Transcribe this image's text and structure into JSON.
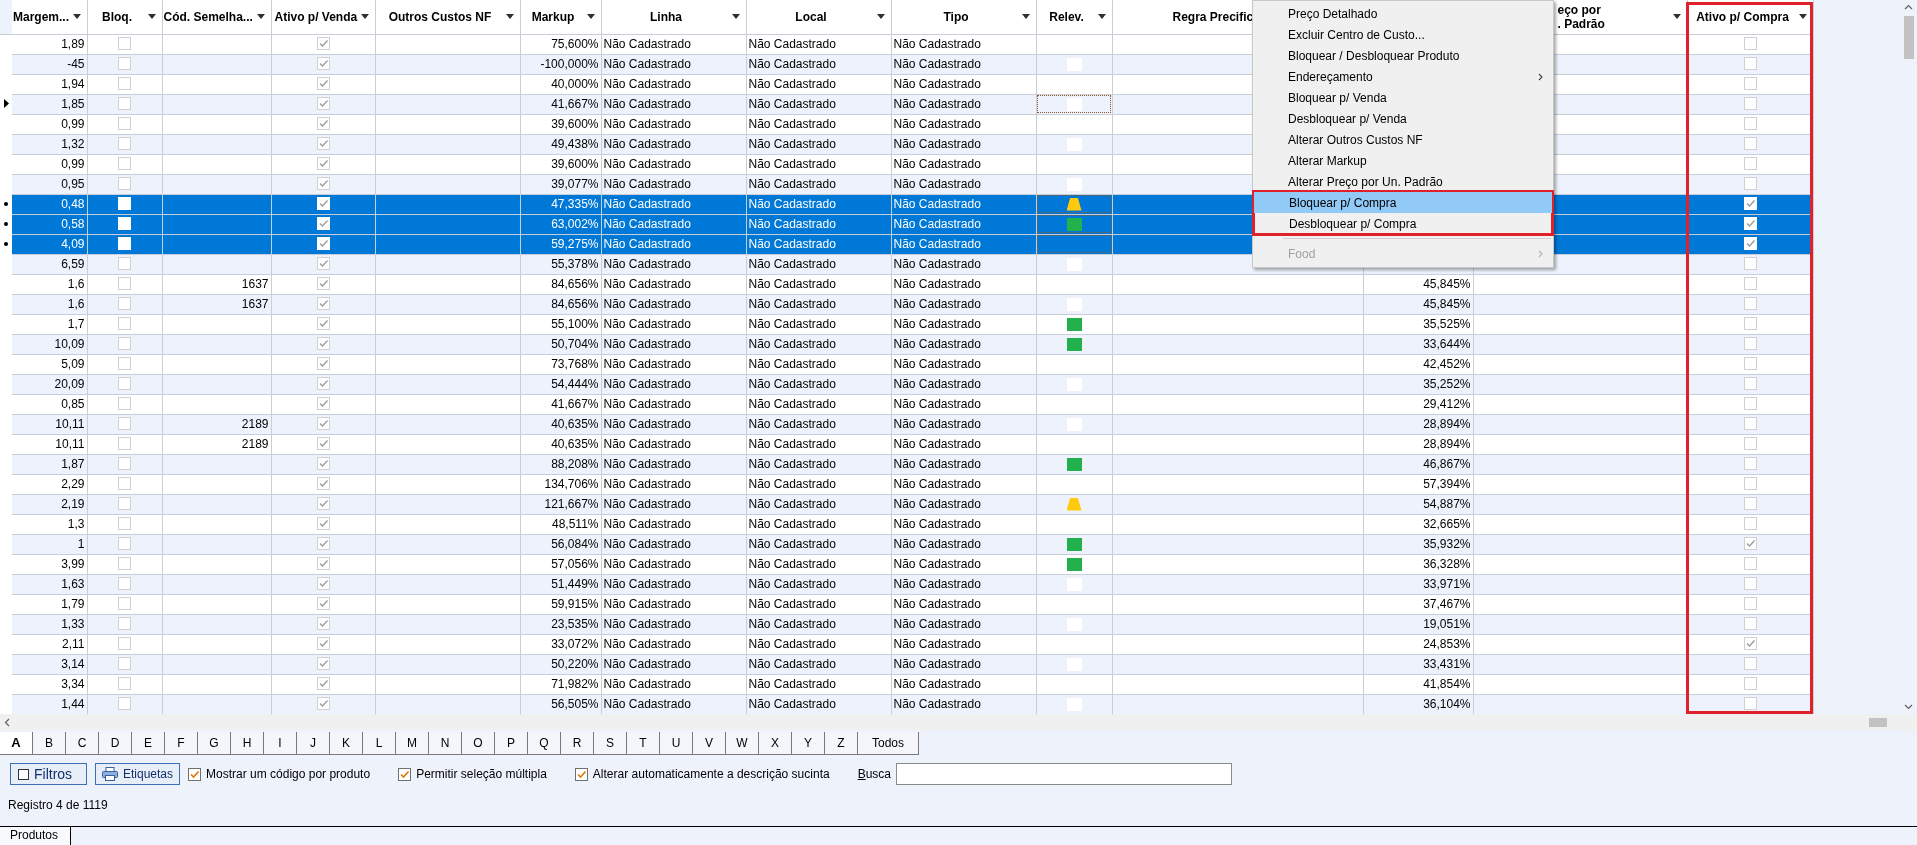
{
  "grid": {
    "columns": [
      {
        "label": "Margem...",
        "kind": "number",
        "dropdown": true
      },
      {
        "label": "Bloq.",
        "kind": "check",
        "dropdown": true
      },
      {
        "label": "Cód. Semelha...",
        "kind": "number",
        "dropdown": true
      },
      {
        "label": "Ativo p/ Venda",
        "kind": "check",
        "dropdown": true
      },
      {
        "label": "Outros Custos NF",
        "kind": "number",
        "dropdown": true
      },
      {
        "label": "Markup",
        "kind": "number",
        "dropdown": true
      },
      {
        "label": "Linha",
        "kind": "text",
        "dropdown": true
      },
      {
        "label": "Local",
        "kind": "text",
        "dropdown": true
      },
      {
        "label": "Tipo",
        "kind": "text",
        "dropdown": true
      },
      {
        "label": "Relev.",
        "kind": "marker",
        "dropdown": true
      },
      {
        "label": "Regra Precific",
        "kind": "text"
      },
      {
        "kind": "number"
      },
      {
        "lines": [
          "eço por",
          ". Padrão"
        ],
        "kind": "number",
        "dropdown": true
      },
      {
        "label": "Ativo p/ Compra",
        "kind": "check",
        "dropdown": true,
        "boxed": true
      }
    ],
    "rows": [
      {
        "selected": false,
        "current": false,
        "cells": [
          "1,89",
          {
            "checked": false
          },
          null,
          {
            "checked": true
          },
          null,
          "75,600%",
          "Não Cadastrado",
          "Não Cadastrado",
          "Não Cadastrado",
          null,
          null,
          null,
          null,
          {
            "checked": false
          }
        ]
      },
      {
        "selected": false,
        "current": false,
        "cells": [
          "-45",
          {
            "checked": false
          },
          null,
          {
            "checked": true
          },
          null,
          "-100,000%",
          "Não Cadastrado",
          "Não Cadastrado",
          "Não Cadastrado",
          {
            "kind": "square",
            "color": "#ffffff"
          },
          null,
          null,
          null,
          {
            "checked": false
          }
        ]
      },
      {
        "selected": false,
        "current": false,
        "cells": [
          "1,94",
          {
            "checked": false
          },
          null,
          {
            "checked": true
          },
          null,
          "40,000%",
          "Não Cadastrado",
          "Não Cadastrado",
          "Não Cadastrado",
          null,
          null,
          null,
          null,
          {
            "checked": false
          }
        ]
      },
      {
        "selected": false,
        "current": true,
        "cells": [
          "1,85",
          {
            "checked": false
          },
          null,
          {
            "checked": true
          },
          null,
          "41,667%",
          "Não Cadastrado",
          "Não Cadastrado",
          "Não Cadastrado",
          {
            "kind": "square",
            "color": "#ffffff"
          },
          null,
          null,
          null,
          {
            "checked": false
          }
        ]
      },
      {
        "selected": false,
        "current": false,
        "cells": [
          "0,99",
          {
            "checked": false
          },
          null,
          {
            "checked": true
          },
          null,
          "39,600%",
          "Não Cadastrado",
          "Não Cadastrado",
          "Não Cadastrado",
          null,
          null,
          null,
          null,
          {
            "checked": false
          }
        ]
      },
      {
        "selected": false,
        "current": false,
        "cells": [
          "1,32",
          {
            "checked": false
          },
          null,
          {
            "checked": true
          },
          null,
          "49,438%",
          "Não Cadastrado",
          "Não Cadastrado",
          "Não Cadastrado",
          {
            "kind": "square",
            "color": "#ffffff"
          },
          null,
          null,
          null,
          {
            "checked": false
          }
        ]
      },
      {
        "selected": false,
        "current": false,
        "cells": [
          "0,99",
          {
            "checked": false
          },
          null,
          {
            "checked": true
          },
          null,
          "39,600%",
          "Não Cadastrado",
          "Não Cadastrado",
          "Não Cadastrado",
          null,
          null,
          null,
          null,
          {
            "checked": false
          }
        ]
      },
      {
        "selected": false,
        "current": false,
        "cells": [
          "0,95",
          {
            "checked": false
          },
          null,
          {
            "checked": true
          },
          null,
          "39,077%",
          "Não Cadastrado",
          "Não Cadastrado",
          "Não Cadastrado",
          {
            "kind": "square",
            "color": "#ffffff"
          },
          null,
          null,
          null,
          {
            "checked": false
          }
        ]
      },
      {
        "selected": true,
        "current": false,
        "cells": [
          "0,48",
          {
            "checked": false
          },
          null,
          {
            "checked": true
          },
          null,
          "47,335%",
          "Não Cadastrado",
          "Não Cadastrado",
          "Não Cadastrado",
          {
            "kind": "trapezoid",
            "color": "#ffc90e"
          },
          null,
          null,
          null,
          {
            "checked": true
          }
        ]
      },
      {
        "selected": true,
        "current": false,
        "cells": [
          "0,58",
          {
            "checked": false
          },
          null,
          {
            "checked": true
          },
          null,
          "63,002%",
          "Não Cadastrado",
          "Não Cadastrado",
          "Não Cadastrado",
          {
            "kind": "square",
            "color": "#22b14c"
          },
          null,
          null,
          null,
          {
            "checked": true
          }
        ]
      },
      {
        "selected": true,
        "current": false,
        "cells": [
          "4,09",
          {
            "checked": false
          },
          null,
          {
            "checked": true
          },
          null,
          "59,275%",
          "Não Cadastrado",
          "Não Cadastrado",
          "Não Cadastrado",
          null,
          null,
          null,
          null,
          {
            "checked": true
          }
        ]
      },
      {
        "selected": false,
        "current": false,
        "cells": [
          "6,59",
          {
            "checked": false
          },
          null,
          {
            "checked": true
          },
          null,
          "55,378%",
          "Não Cadastrado",
          "Não Cadastrado",
          "Não Cadastrado",
          {
            "kind": "square",
            "color": "#ffffff"
          },
          null,
          null,
          null,
          {
            "checked": false
          }
        ]
      },
      {
        "selected": false,
        "current": false,
        "cells": [
          "1,6",
          {
            "checked": false
          },
          "1637",
          {
            "checked": true
          },
          null,
          "84,656%",
          "Não Cadastrado",
          "Não Cadastrado",
          "Não Cadastrado",
          null,
          null,
          "45,845%",
          null,
          {
            "checked": false
          }
        ]
      },
      {
        "selected": false,
        "current": false,
        "cells": [
          "1,6",
          {
            "checked": false
          },
          "1637",
          {
            "checked": true
          },
          null,
          "84,656%",
          "Não Cadastrado",
          "Não Cadastrado",
          "Não Cadastrado",
          {
            "kind": "square",
            "color": "#ffffff"
          },
          null,
          "45,845%",
          null,
          {
            "checked": false
          }
        ]
      },
      {
        "selected": false,
        "current": false,
        "cells": [
          "1,7",
          {
            "checked": false
          },
          null,
          {
            "checked": true
          },
          null,
          "55,100%",
          "Não Cadastrado",
          "Não Cadastrado",
          "Não Cadastrado",
          {
            "kind": "square",
            "color": "#22b14c"
          },
          null,
          "35,525%",
          null,
          {
            "checked": false
          }
        ]
      },
      {
        "selected": false,
        "current": false,
        "cells": [
          "10,09",
          {
            "checked": false
          },
          null,
          {
            "checked": true
          },
          null,
          "50,704%",
          "Não Cadastrado",
          "Não Cadastrado",
          "Não Cadastrado",
          {
            "kind": "square",
            "color": "#22b14c"
          },
          null,
          "33,644%",
          null,
          {
            "checked": false
          }
        ]
      },
      {
        "selected": false,
        "current": false,
        "cells": [
          "5,09",
          {
            "checked": false
          },
          null,
          {
            "checked": true
          },
          null,
          "73,768%",
          "Não Cadastrado",
          "Não Cadastrado",
          "Não Cadastrado",
          null,
          null,
          "42,452%",
          null,
          {
            "checked": false
          }
        ]
      },
      {
        "selected": false,
        "current": false,
        "cells": [
          "20,09",
          {
            "checked": false
          },
          null,
          {
            "checked": true
          },
          null,
          "54,444%",
          "Não Cadastrado",
          "Não Cadastrado",
          "Não Cadastrado",
          {
            "kind": "square",
            "color": "#ffffff"
          },
          null,
          "35,252%",
          null,
          {
            "checked": false
          }
        ]
      },
      {
        "selected": false,
        "current": false,
        "cells": [
          "0,85",
          {
            "checked": false
          },
          null,
          {
            "checked": true
          },
          null,
          "41,667%",
          "Não Cadastrado",
          "Não Cadastrado",
          "Não Cadastrado",
          null,
          null,
          "29,412%",
          null,
          {
            "checked": false
          }
        ]
      },
      {
        "selected": false,
        "current": false,
        "cells": [
          "10,11",
          {
            "checked": false
          },
          "2189",
          {
            "checked": true
          },
          null,
          "40,635%",
          "Não Cadastrado",
          "Não Cadastrado",
          "Não Cadastrado",
          {
            "kind": "square",
            "color": "#ffffff"
          },
          null,
          "28,894%",
          null,
          {
            "checked": false
          }
        ]
      },
      {
        "selected": false,
        "current": false,
        "cells": [
          "10,11",
          {
            "checked": false
          },
          "2189",
          {
            "checked": true
          },
          null,
          "40,635%",
          "Não Cadastrado",
          "Não Cadastrado",
          "Não Cadastrado",
          null,
          null,
          "28,894%",
          null,
          {
            "checked": false
          }
        ]
      },
      {
        "selected": false,
        "current": false,
        "cells": [
          "1,87",
          {
            "checked": false
          },
          null,
          {
            "checked": true
          },
          null,
          "88,208%",
          "Não Cadastrado",
          "Não Cadastrado",
          "Não Cadastrado",
          {
            "kind": "square",
            "color": "#22b14c"
          },
          null,
          "46,867%",
          null,
          {
            "checked": false
          }
        ]
      },
      {
        "selected": false,
        "current": false,
        "cells": [
          "2,29",
          {
            "checked": false
          },
          null,
          {
            "checked": true
          },
          null,
          "134,706%",
          "Não Cadastrado",
          "Não Cadastrado",
          "Não Cadastrado",
          null,
          null,
          "57,394%",
          null,
          {
            "checked": false
          }
        ]
      },
      {
        "selected": false,
        "current": false,
        "cells": [
          "2,19",
          {
            "checked": false
          },
          null,
          {
            "checked": true
          },
          null,
          "121,667%",
          "Não Cadastrado",
          "Não Cadastrado",
          "Não Cadastrado",
          {
            "kind": "trapezoid",
            "color": "#ffc90e"
          },
          null,
          "54,887%",
          null,
          {
            "checked": false
          }
        ]
      },
      {
        "selected": false,
        "current": false,
        "cells": [
          "1,3",
          {
            "checked": false
          },
          null,
          {
            "checked": true
          },
          null,
          "48,511%",
          "Não Cadastrado",
          "Não Cadastrado",
          "Não Cadastrado",
          null,
          null,
          "32,665%",
          null,
          {
            "checked": false
          }
        ]
      },
      {
        "selected": false,
        "current": false,
        "cells": [
          "1",
          {
            "checked": false
          },
          null,
          {
            "checked": true
          },
          null,
          "56,084%",
          "Não Cadastrado",
          "Não Cadastrado",
          "Não Cadastrado",
          {
            "kind": "square",
            "color": "#22b14c"
          },
          null,
          "35,932%",
          null,
          {
            "checked": true
          }
        ]
      },
      {
        "selected": false,
        "current": false,
        "cells": [
          "3,99",
          {
            "checked": false
          },
          null,
          {
            "checked": true
          },
          null,
          "57,056%",
          "Não Cadastrado",
          "Não Cadastrado",
          "Não Cadastrado",
          {
            "kind": "square",
            "color": "#22b14c"
          },
          null,
          "36,328%",
          null,
          {
            "checked": false
          }
        ]
      },
      {
        "selected": false,
        "current": false,
        "cells": [
          "1,63",
          {
            "checked": false
          },
          null,
          {
            "checked": true
          },
          null,
          "51,449%",
          "Não Cadastrado",
          "Não Cadastrado",
          "Não Cadastrado",
          {
            "kind": "square",
            "color": "#ffffff"
          },
          null,
          "33,971%",
          null,
          {
            "checked": false
          }
        ]
      },
      {
        "selected": false,
        "current": false,
        "cells": [
          "1,79",
          {
            "checked": false
          },
          null,
          {
            "checked": true
          },
          null,
          "59,915%",
          "Não Cadastrado",
          "Não Cadastrado",
          "Não Cadastrado",
          null,
          null,
          "37,467%",
          null,
          {
            "checked": false
          }
        ]
      },
      {
        "selected": false,
        "current": false,
        "cells": [
          "1,33",
          {
            "checked": false
          },
          null,
          {
            "checked": true
          },
          null,
          "23,535%",
          "Não Cadastrado",
          "Não Cadastrado",
          "Não Cadastrado",
          {
            "kind": "square",
            "color": "#ffffff"
          },
          null,
          "19,051%",
          null,
          {
            "checked": false
          }
        ]
      },
      {
        "selected": false,
        "current": false,
        "cells": [
          "2,11",
          {
            "checked": false
          },
          null,
          {
            "checked": true
          },
          null,
          "33,072%",
          "Não Cadastrado",
          "Não Cadastrado",
          "Não Cadastrado",
          null,
          null,
          "24,853%",
          null,
          {
            "checked": true
          }
        ]
      },
      {
        "selected": false,
        "current": false,
        "cells": [
          "3,14",
          {
            "checked": false
          },
          null,
          {
            "checked": true
          },
          null,
          "50,220%",
          "Não Cadastrado",
          "Não Cadastrado",
          "Não Cadastrado",
          {
            "kind": "square",
            "color": "#ffffff"
          },
          null,
          "33,431%",
          null,
          {
            "checked": false
          }
        ]
      },
      {
        "selected": false,
        "current": false,
        "cells": [
          "3,34",
          {
            "checked": false
          },
          null,
          {
            "checked": true
          },
          null,
          "71,982%",
          "Não Cadastrado",
          "Não Cadastrado",
          "Não Cadastrado",
          null,
          null,
          "41,854%",
          null,
          {
            "checked": false
          }
        ]
      },
      {
        "selected": false,
        "current": false,
        "cells": [
          "1,44",
          {
            "checked": false
          },
          null,
          {
            "checked": true
          },
          null,
          "56,505%",
          "Não Cadastrado",
          "Não Cadastrado",
          "Não Cadastrado",
          {
            "kind": "square",
            "color": "#ffffff"
          },
          null,
          "36,104%",
          null,
          {
            "checked": false
          }
        ]
      }
    ]
  },
  "context_menu": {
    "items": [
      {
        "kind": "item",
        "label": "Preço Detalhado",
        "selected": false,
        "disabled": false,
        "submenu": false,
        "boxed": false
      },
      {
        "kind": "item",
        "label": "Excluir Centro de Custo...",
        "selected": false,
        "disabled": false,
        "submenu": false,
        "boxed": false
      },
      {
        "kind": "item",
        "label": "Bloquear / Desbloquear Produto",
        "selected": false,
        "disabled": false,
        "submenu": false,
        "boxed": false
      },
      {
        "kind": "item",
        "label": "Endereçamento",
        "selected": false,
        "disabled": false,
        "submenu": true,
        "boxed": false
      },
      {
        "kind": "item",
        "label": "Bloquear p/ Venda",
        "selected": false,
        "disabled": false,
        "submenu": false,
        "boxed": false
      },
      {
        "kind": "item",
        "label": "Desbloquear p/ Venda",
        "selected": false,
        "disabled": false,
        "submenu": false,
        "boxed": false
      },
      {
        "kind": "item",
        "label": "Alterar Outros Custos NF",
        "selected": false,
        "disabled": false,
        "submenu": false,
        "boxed": false
      },
      {
        "kind": "item",
        "label": "Alterar Markup",
        "selected": false,
        "disabled": false,
        "submenu": false,
        "boxed": false
      },
      {
        "kind": "item",
        "label": "Alterar Preço por Un. Padrão",
        "selected": false,
        "disabled": false,
        "submenu": false,
        "boxed": false
      },
      {
        "kind": "item",
        "label": "Bloquear p/ Compra",
        "selected": true,
        "disabled": false,
        "submenu": false,
        "boxed": true
      },
      {
        "kind": "item",
        "label": "Desbloquear p/ Compra",
        "selected": false,
        "disabled": false,
        "submenu": false,
        "boxed": true
      },
      {
        "kind": "separator"
      },
      {
        "kind": "item",
        "label": "Food",
        "selected": false,
        "disabled": true,
        "submenu": true,
        "boxed": false
      }
    ]
  },
  "letter_tabs": [
    {
      "label": "A",
      "selected": true
    },
    {
      "label": "B",
      "selected": false
    },
    {
      "label": "C",
      "selected": false
    },
    {
      "label": "D",
      "selected": false
    },
    {
      "label": "E",
      "selected": false
    },
    {
      "label": "F",
      "selected": false
    },
    {
      "label": "G",
      "selected": false
    },
    {
      "label": "H",
      "selected": false
    },
    {
      "label": "I",
      "selected": false
    },
    {
      "label": "J",
      "selected": false
    },
    {
      "label": "K",
      "selected": false
    },
    {
      "label": "L",
      "selected": false
    },
    {
      "label": "M",
      "selected": false
    },
    {
      "label": "N",
      "selected": false
    },
    {
      "label": "O",
      "selected": false
    },
    {
      "label": "P",
      "selected": false
    },
    {
      "label": "Q",
      "selected": false
    },
    {
      "label": "R",
      "selected": false
    },
    {
      "label": "S",
      "selected": false
    },
    {
      "label": "T",
      "selected": false
    },
    {
      "label": "U",
      "selected": false
    },
    {
      "label": "V",
      "selected": false
    },
    {
      "label": "W",
      "selected": false
    },
    {
      "label": "X",
      "selected": false
    },
    {
      "label": "Y",
      "selected": false
    },
    {
      "label": "Z",
      "selected": false
    },
    {
      "label": "Todos",
      "selected": false
    }
  ],
  "toolbar": {
    "buttons": [
      {
        "label": "Filtros"
      },
      {
        "label": "Etiquetas"
      }
    ],
    "options": [
      {
        "label": "Mostrar um código por produto",
        "checked": true
      },
      {
        "label": "Permitir seleção múltipla",
        "checked": true
      },
      {
        "label": "Alterar automaticamente a descrição sucinta",
        "checked": true
      }
    ],
    "search": {
      "label": "Busca"
    }
  },
  "status": "Registro 4 de 1119",
  "sheet_tabs": [
    {
      "label": "Produtos",
      "selected": true
    }
  ]
}
